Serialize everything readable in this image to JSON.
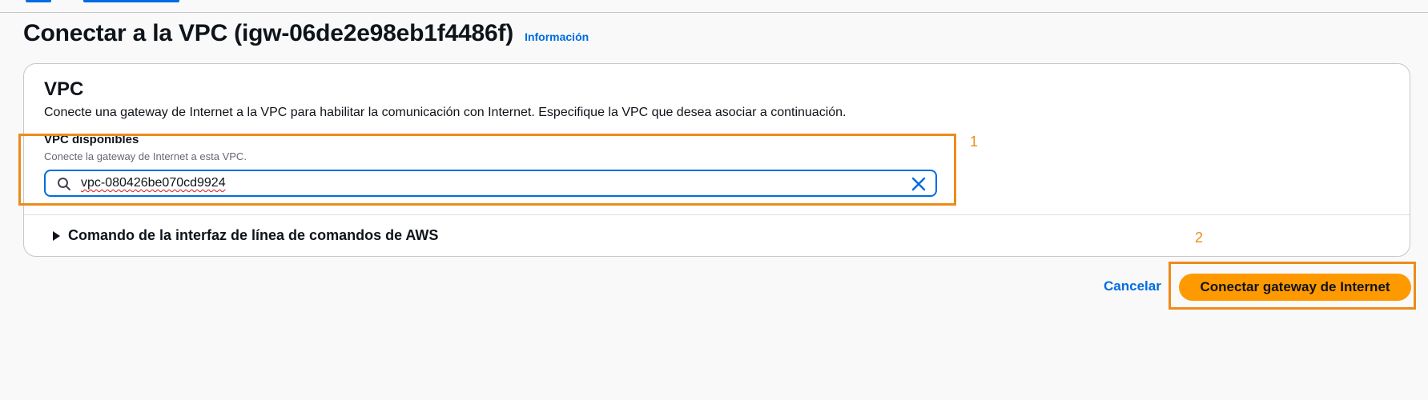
{
  "header": {
    "title": "Conectar a la VPC (igw-06de2e98eb1f4486f)",
    "info_link": "Información"
  },
  "vpc_section": {
    "title": "VPC",
    "description": "Conecte una gateway de Internet a la VPC para habilitar la comunicación con Internet. Especifique la VPC que desea asociar a continuación.",
    "field": {
      "label": "VPC disponibles",
      "description": "Conecte la gateway de Internet a esta VPC.",
      "value": "vpc-080426be070cd9924"
    },
    "cli_expander": {
      "label": "Comando de la interfaz de línea de comandos de AWS",
      "expanded": false
    }
  },
  "actions": {
    "cancel_label": "Cancelar",
    "submit_label": "Conectar gateway de Internet"
  },
  "annotations": [
    {
      "number": "1"
    },
    {
      "number": "2"
    }
  ],
  "colors": {
    "accent_link": "#006ce0",
    "primary_button": "#ff9900",
    "annotation": "#ec8b1b"
  }
}
